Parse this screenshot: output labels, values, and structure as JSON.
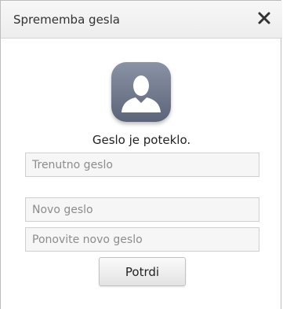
{
  "dialog": {
    "title": "Sprememba gesla",
    "close_label": "close"
  },
  "message": "Geslo je poteklo.",
  "form": {
    "current_password": {
      "value": "",
      "placeholder": "Trenutno geslo"
    },
    "new_password": {
      "value": "",
      "placeholder": "Novo geslo"
    },
    "repeat_password": {
      "value": "",
      "placeholder": "Ponovite novo geslo"
    },
    "submit_label": "Potrdi"
  },
  "icons": {
    "close": "close-icon",
    "avatar": "user-avatar-icon"
  },
  "colors": {
    "avatar_bg": "#6f788c",
    "header_bg": "#efefef",
    "field_bg": "#f6f6f6"
  }
}
